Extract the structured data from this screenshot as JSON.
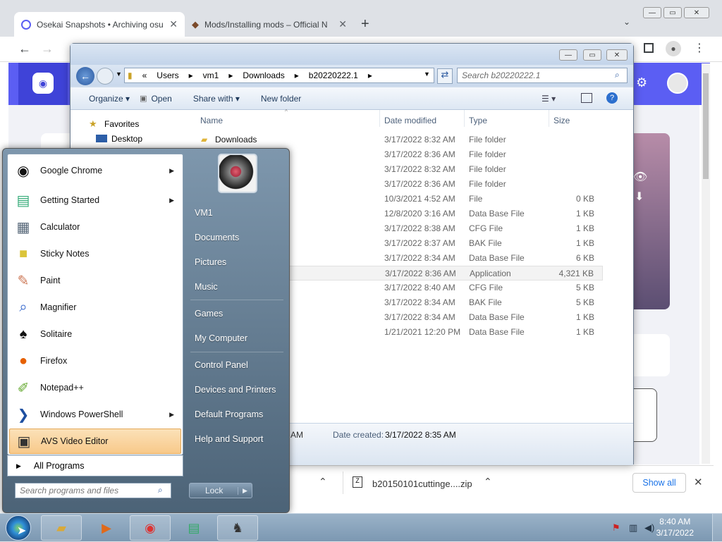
{
  "browser": {
    "tabs": [
      {
        "title": "Osekai Snapshots • Archiving osu"
      },
      {
        "title": "Mods/Installing mods – Official N"
      }
    ],
    "new_tab": "+",
    "download_bar": {
      "item_name": "b20150101cuttinge....zip",
      "show_all": "Show all"
    }
  },
  "explorer": {
    "breadcrumb": [
      "«",
      "Users",
      "▸",
      "vm1",
      "▸",
      "Downloads",
      "▸",
      "b20220222.1",
      "▸"
    ],
    "search_placeholder": "Search b20220222.1",
    "commands": {
      "organize": "Organize ▾",
      "open": "Open",
      "share": "Share with ▾",
      "new_folder": "New folder"
    },
    "nav": {
      "favorites": "Favorites",
      "desktop": "Desktop"
    },
    "columns": {
      "name": "Name",
      "date": "Date modified",
      "type": "Type",
      "size": "Size"
    },
    "rows": [
      {
        "name": "Downloads",
        "date": "3/17/2022 8:32 AM",
        "type": "File folder",
        "size": ""
      },
      {
        "name": "",
        "date": "3/17/2022 8:36 AM",
        "type": "File folder",
        "size": ""
      },
      {
        "name": "",
        "date": "3/17/2022 8:32 AM",
        "type": "File folder",
        "size": ""
      },
      {
        "name": "",
        "date": "3/17/2022 8:36 AM",
        "type": "File folder",
        "size": ""
      },
      {
        "name": "",
        "date": "10/3/2021 4:52 AM",
        "type": "File",
        "size": "0 KB"
      },
      {
        "name": "",
        "date": "12/8/2020 3:16 AM",
        "type": "Data Base File",
        "size": "1 KB"
      },
      {
        "name": "",
        "date": "3/17/2022 8:38 AM",
        "type": "CFG File",
        "size": "1 KB"
      },
      {
        "name": "",
        "date": "3/17/2022 8:37 AM",
        "type": "BAK File",
        "size": "1 KB"
      },
      {
        "name": "",
        "date": "3/17/2022 8:34 AM",
        "type": "Data Base File",
        "size": "6 KB"
      },
      {
        "name": "",
        "date": "3/17/2022 8:36 AM",
        "type": "Application",
        "size": "4,321 KB"
      },
      {
        "name": "",
        "date": "3/17/2022 8:40 AM",
        "type": "CFG File",
        "size": "5 KB"
      },
      {
        "name": "",
        "date": "3/17/2022 8:34 AM",
        "type": "BAK File",
        "size": "5 KB"
      },
      {
        "name": "",
        "date": "3/17/2022 8:34 AM",
        "type": "Data Base File",
        "size": "1 KB"
      },
      {
        "name": "",
        "date": "1/21/2021 12:20 PM",
        "type": "Data Base File",
        "size": "1 KB"
      }
    ],
    "details": {
      "time_fragment": "AM",
      "created_label": "Date created:",
      "created_value": "3/17/2022 8:35 AM"
    }
  },
  "start_menu": {
    "programs": [
      {
        "label": "Google Chrome",
        "icon": "chrome-icon",
        "arrow": "▶"
      },
      {
        "label": "Getting Started",
        "icon": "getting-started-icon",
        "arrow": "▶"
      },
      {
        "label": "Calculator",
        "icon": "calculator-icon",
        "arrow": ""
      },
      {
        "label": "Sticky Notes",
        "icon": "sticky-notes-icon",
        "arrow": ""
      },
      {
        "label": "Paint",
        "icon": "paint-icon",
        "arrow": ""
      },
      {
        "label": "Magnifier",
        "icon": "magnifier-icon",
        "arrow": ""
      },
      {
        "label": "Solitaire",
        "icon": "solitaire-icon",
        "arrow": ""
      },
      {
        "label": "Firefox",
        "icon": "firefox-icon",
        "arrow": ""
      },
      {
        "label": "Notepad++",
        "icon": "notepadpp-icon",
        "arrow": ""
      },
      {
        "label": "Windows PowerShell",
        "icon": "powershell-icon",
        "arrow": "▶"
      },
      {
        "label": "AVS Video Editor",
        "icon": "avs-video-editor-icon",
        "arrow": ""
      }
    ],
    "all_programs": "All Programs",
    "search_placeholder": "Search programs and files",
    "places": [
      "VM1",
      "Documents",
      "Pictures",
      "Music",
      "Games",
      "My Computer",
      "Control Panel",
      "Devices and Printers",
      "Default Programs",
      "Help and Support"
    ],
    "lock": "Lock"
  },
  "taskbar": {
    "time": "8:40 AM",
    "date": "3/17/2022"
  }
}
